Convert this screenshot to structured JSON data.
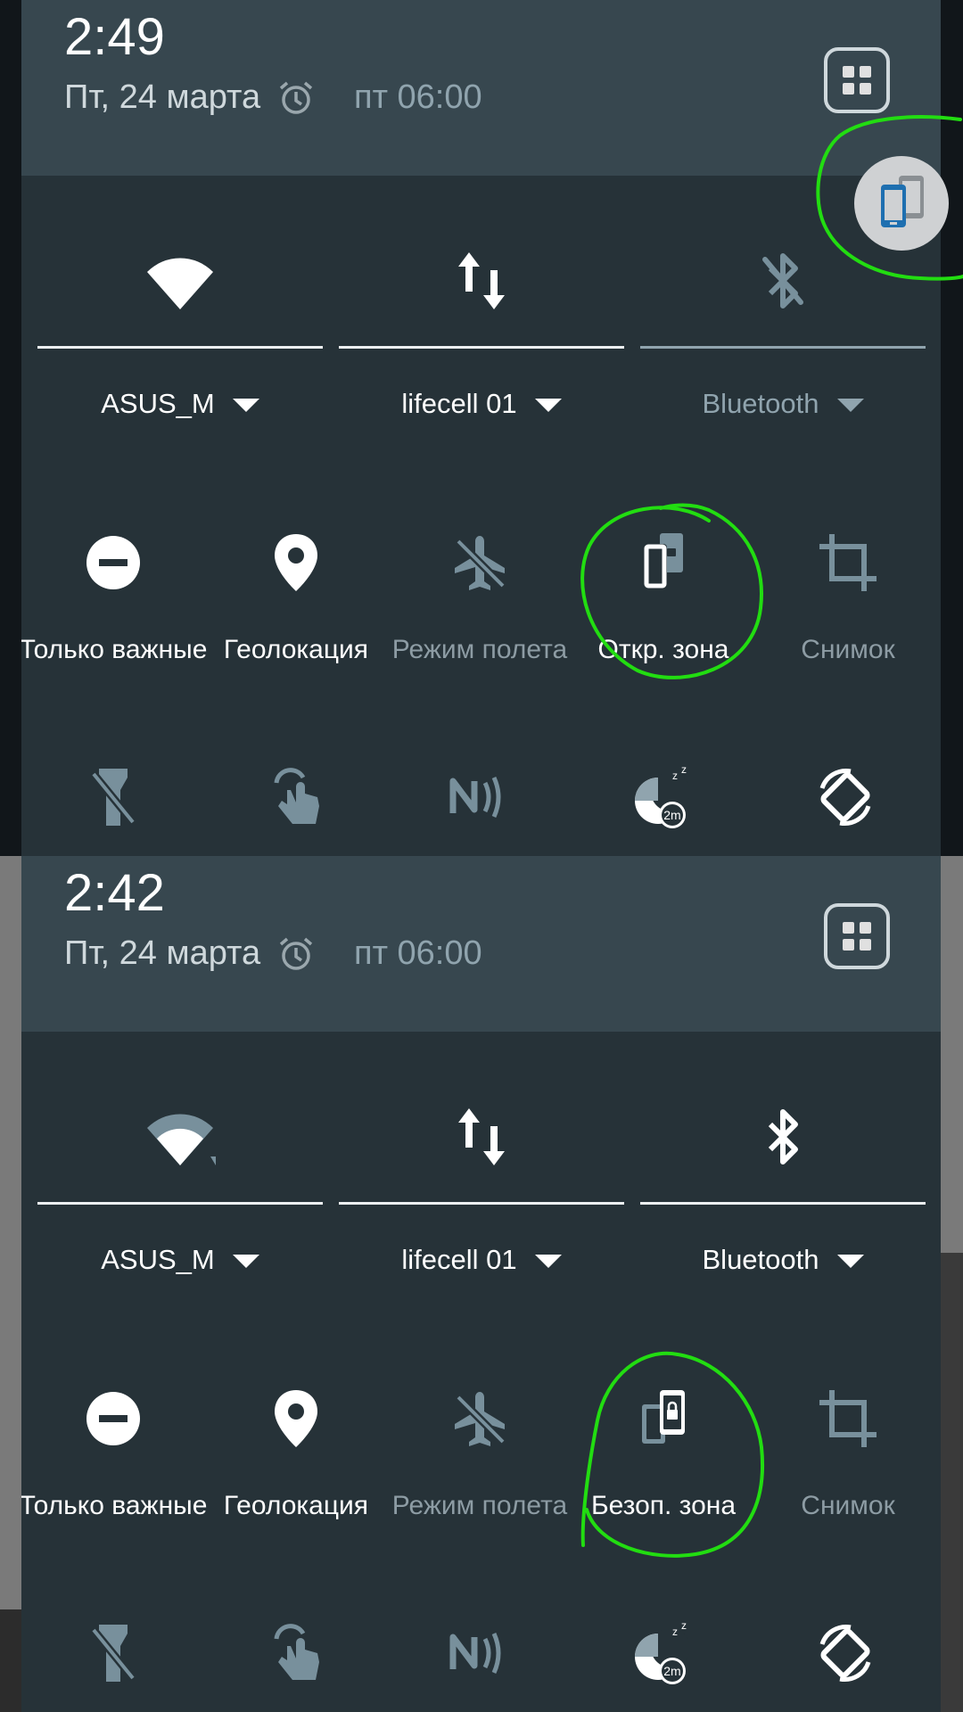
{
  "panels": [
    {
      "status": {
        "time": "2:49",
        "date": "Пт, 24 марта",
        "alarm_icon": "alarm-clock-icon",
        "alarm_time": "пт 06:00",
        "settings_icon": "grid-settings-icon"
      },
      "big_tiles": [
        {
          "icon": "wifi-icon",
          "label": "ASUS_M"
        },
        {
          "icon": "mobile-data-icon",
          "label": "lifecell 01"
        },
        {
          "icon": "bluetooth-off-icon",
          "label": "Bluetooth"
        }
      ],
      "small_tiles": [
        {
          "icon": "do-not-disturb-icon",
          "label": "Только важные"
        },
        {
          "icon": "location-pin-icon",
          "label": "Геолокация"
        },
        {
          "icon": "airplane-icon",
          "label": "Режим полета"
        },
        {
          "icon": "open-zone-icon",
          "label": "Откр. зона"
        },
        {
          "icon": "screenshot-crop-icon",
          "label": "Снимок"
        }
      ],
      "bottom_icons": [
        "flashlight-icon",
        "touch-gesture-icon",
        "nfc-icon",
        "sleep-timer-icon",
        "auto-rotate-icon"
      ],
      "sleep_badge": "2m"
    },
    {
      "status": {
        "time": "2:42",
        "date": "Пт, 24 марта",
        "alarm_icon": "alarm-clock-icon",
        "alarm_time": "пт 06:00",
        "settings_icon": "grid-settings-icon"
      },
      "big_tiles": [
        {
          "icon": "wifi-icon",
          "label": "ASUS_M"
        },
        {
          "icon": "mobile-data-icon",
          "label": "lifecell 01"
        },
        {
          "icon": "bluetooth-icon",
          "label": "Bluetooth"
        }
      ],
      "small_tiles": [
        {
          "icon": "do-not-disturb-icon",
          "label": "Только важные"
        },
        {
          "icon": "location-pin-icon",
          "label": "Геолокация"
        },
        {
          "icon": "airplane-icon",
          "label": "Режим полета"
        },
        {
          "icon": "secure-zone-icon",
          "label": "Безоп. зона"
        },
        {
          "icon": "screenshot-crop-icon",
          "label": "Снимок"
        }
      ],
      "bottom_icons": [
        "flashlight-icon",
        "touch-gesture-icon",
        "nfc-icon",
        "sleep-timer-icon",
        "auto-rotate-icon"
      ],
      "sleep_badge": "2m"
    }
  ],
  "floating_button": {
    "icon": "dual-phone-icon"
  },
  "colors": {
    "panel_bg": "#263238",
    "header_bg": "#37474f",
    "annotation": "#22dd11",
    "dim_text": "#90a4ae"
  }
}
